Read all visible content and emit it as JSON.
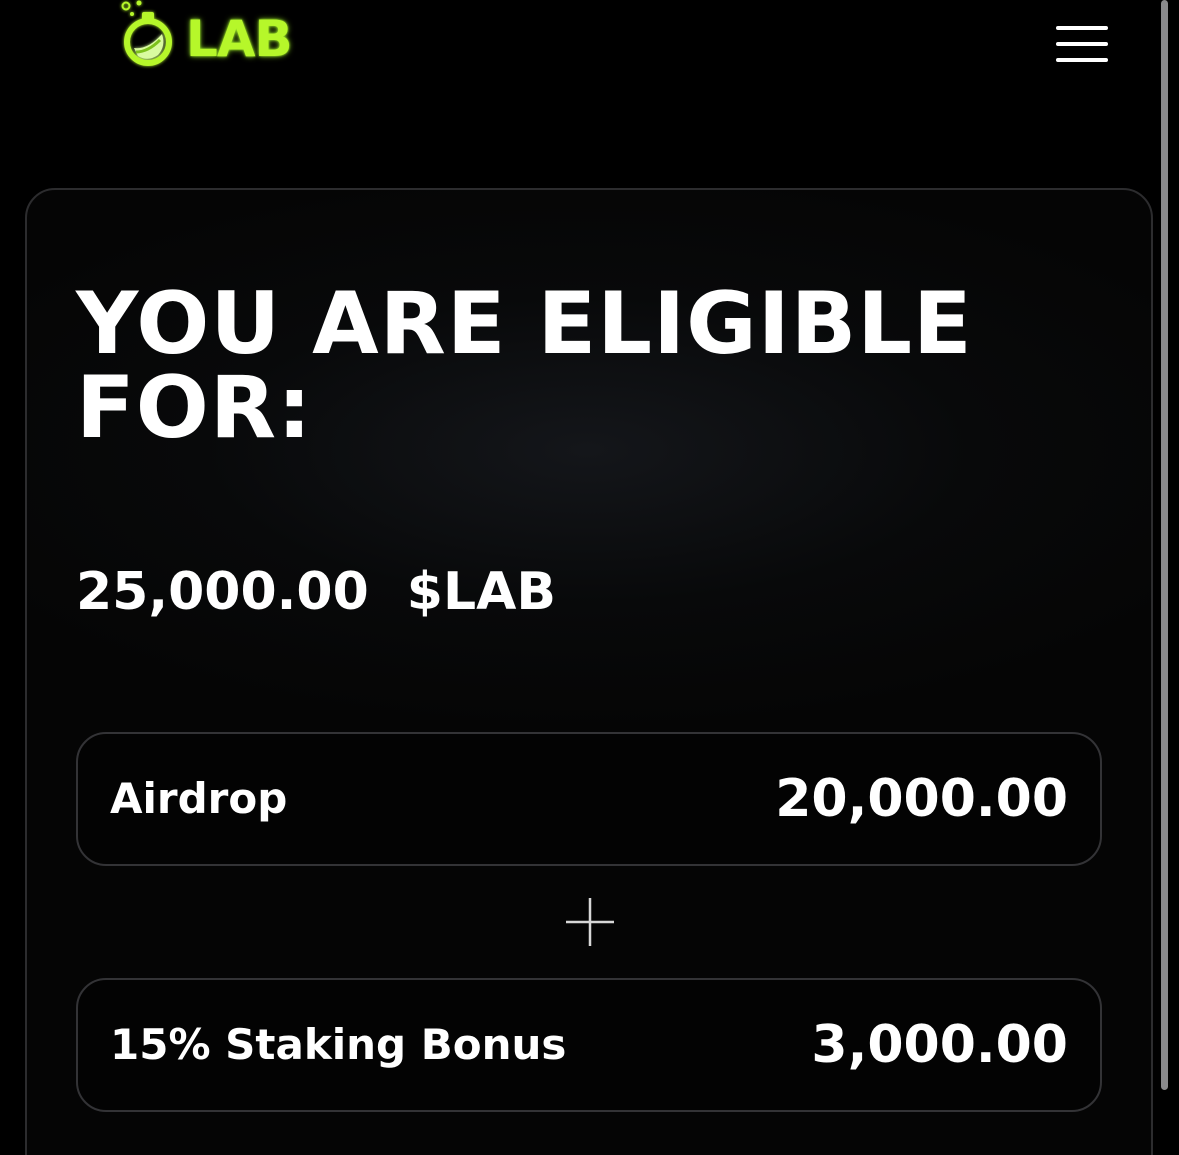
{
  "header": {
    "logo_text": "LAB",
    "logo_icon": "flask-icon",
    "menu_icon": "hamburger-menu-icon",
    "accent_color": "#b6f72a"
  },
  "eligibility": {
    "title": "YOU ARE ELIGIBLE FOR:",
    "total_amount": "25,000.00",
    "total_currency": "$LAB",
    "breakdown": [
      {
        "label": "Airdrop",
        "value": "20,000.00"
      },
      {
        "label": "15% Staking Bonus",
        "value": "3,000.00"
      }
    ],
    "separator_icon": "plus-icon"
  }
}
